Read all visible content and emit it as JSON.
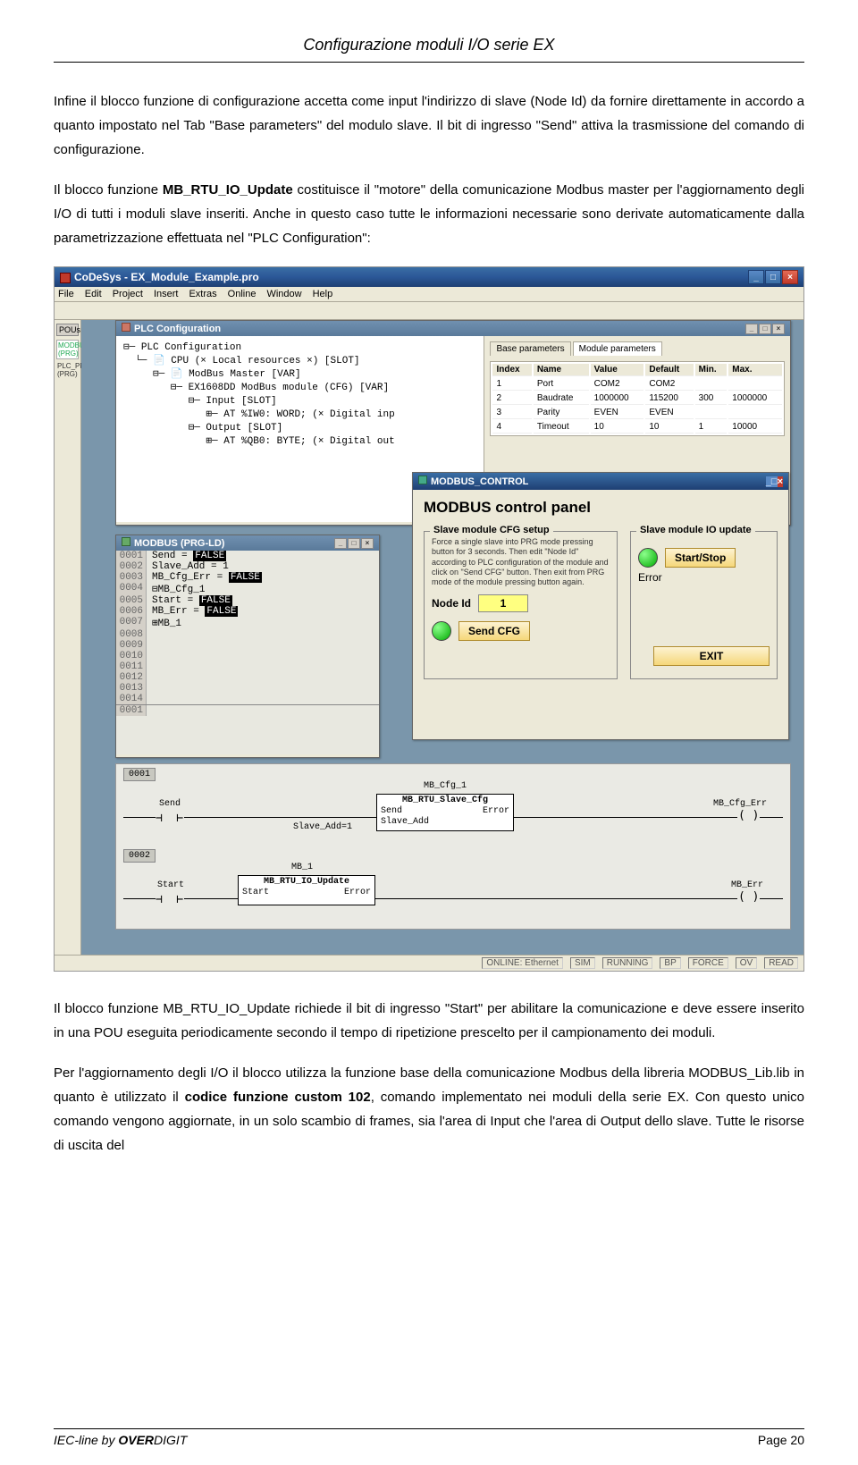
{
  "header": {
    "title": "Configurazione moduli I/O serie EX"
  },
  "para1": "Infine il blocco funzione di configurazione accetta come input l'indirizzo di slave (Node Id) da fornire direttamente in accordo a quanto impostato nel Tab \"Base parameters\" del modulo slave. Il bit di ingresso \"Send\" attiva la trasmissione del comando di configurazione.",
  "para2a": "Il blocco funzione ",
  "para2_fb": "MB_RTU_IO_Update",
  "para2b": " costituisce il \"motore\" della comunicazione Modbus master per l'aggiornamento degli I/O di tutti i moduli slave inseriti. Anche in questo caso tutte le informazioni necessarie sono derivate automaticamente dalla parametrizzazione effettuata nel \"PLC Configuration\":",
  "ide": {
    "title": "CoDeSys - EX_Module_Example.pro",
    "menus": [
      "File",
      "Edit",
      "Project",
      "Insert",
      "Extras",
      "Online",
      "Window",
      "Help"
    ],
    "side": {
      "heading": "POUs",
      "items": [
        "MODBUS (PRG)",
        "PLC_PRG (PRG)"
      ]
    },
    "plcconf": {
      "title": "PLC Configuration",
      "tree": [
        "⊟─ PLC Configuration",
        "  └─ 📄 CPU (× Local resources ×) [SLOT]",
        "     ⊟─ 📄 ModBus Master [VAR]",
        "        ⊟─ EX1608DD ModBus module (CFG) [VAR]",
        "           ⊟─ Input [SLOT]",
        "              ⊞─ AT %IW0: WORD; (× Digital inp",
        "           ⊟─ Output [SLOT]",
        "              ⊞─ AT %QB0: BYTE; (× Digital out"
      ],
      "tabs": [
        "Base parameters",
        "Module parameters"
      ],
      "grid": {
        "cols": [
          "Index",
          "Name",
          "Value",
          "Default",
          "Min.",
          "Max."
        ],
        "rows": [
          [
            "1",
            "Port",
            "COM2",
            "COM2",
            "",
            ""
          ],
          [
            "2",
            "Baudrate",
            "1000000",
            "115200",
            "300",
            "1000000"
          ],
          [
            "3",
            "Parity",
            "EVEN",
            "EVEN",
            "",
            ""
          ],
          [
            "4",
            "Timeout",
            "10",
            "10",
            "1",
            "10000"
          ]
        ]
      }
    },
    "modctl": {
      "wintitle": "MODBUS_CONTROL",
      "heading": "MODBUS control panel",
      "left_legend": "Slave module CFG setup",
      "right_legend": "Slave module IO update",
      "hint": "Force a single slave into PRG mode pressing button for 3 seconds. Then edit \"Node Id\" according to PLC configuration of the module and click on \"Send CFG\" button. Then exit from PRG mode of the module pressing button again.",
      "nodeid_label": "Node Id",
      "nodeid_value": "1",
      "sendcfg_btn": "Send CFG",
      "error_label": "Error",
      "startstop_btn": "Start/Stop",
      "exit_btn": "EXIT"
    },
    "prgld": {
      "title": "MODBUS (PRG-LD)",
      "lines": [
        {
          "n": "0001",
          "c": "Send = ",
          "inv": "FALSE"
        },
        {
          "n": "0002",
          "c": "Slave_Add = 1"
        },
        {
          "n": "0003",
          "c": "MB_Cfg_Err = ",
          "inv": "FALSE"
        },
        {
          "n": "0004",
          "pre": "⊟",
          "c": "MB_Cfg_1"
        },
        {
          "n": "0005",
          "c": "Start = ",
          "inv": "FALSE"
        },
        {
          "n": "0006",
          "c": "MB_Err = ",
          "inv": "FALSE"
        },
        {
          "n": "0007",
          "pre": "⊞",
          "c": "MB_1"
        },
        {
          "n": "0008",
          "c": ""
        },
        {
          "n": "0009",
          "c": ""
        },
        {
          "n": "0010",
          "c": ""
        },
        {
          "n": "0011",
          "c": ""
        },
        {
          "n": "0012",
          "c": ""
        },
        {
          "n": "0013",
          "c": ""
        },
        {
          "n": "0014",
          "c": ""
        }
      ],
      "sep": "0001"
    },
    "ladder": {
      "r1_num": "0001",
      "r1_send": "Send",
      "r1_fb_inst": "MB_Cfg_1",
      "r1_fb_type": "MB_RTU_Slave_Cfg",
      "r1_in_send": "Send",
      "r1_out_err": "Error",
      "r1_in_slave": "Slave_Add=1",
      "r1_in_slave_port": "Slave_Add",
      "r1_out": "MB_Cfg_Err",
      "r2_num": "0002",
      "r2_start": "Start",
      "r2_fb_inst": "MB_1",
      "r2_fb_type": "MB_RTU_IO_Update",
      "r2_in_start": "Start",
      "r2_out_err": "Error",
      "r2_out": "MB_Err"
    },
    "status": [
      "ONLINE: Ethernet",
      "SIM",
      "RUNNING",
      "BP",
      "FORCE",
      "OV",
      "READ"
    ]
  },
  "para3": "Il blocco funzione MB_RTU_IO_Update richiede il bit di ingresso \"Start\" per abilitare la comunicazione e deve essere inserito in una POU eseguita periodicamente secondo il tempo di ripetizione prescelto per il campionamento dei moduli.",
  "para4a": "Per l'aggiornamento degli I/O il blocco utilizza la funzione base della comunicazione Modbus della libreria MODBUS_Lib.lib in quanto è utilizzato il ",
  "para4_bold": "codice funzione custom 102",
  "para4b": ", comando implementato nei moduli della serie EX. Con questo unico comando vengono aggiornate, in un solo scambio di frames, sia l'area di Input che l'area di Output dello slave. Tutte le risorse di uscita del",
  "footer": {
    "left_a": "IEC-line by ",
    "left_b": "OVER",
    "left_c": "DIGIT",
    "right": "Page 20"
  }
}
